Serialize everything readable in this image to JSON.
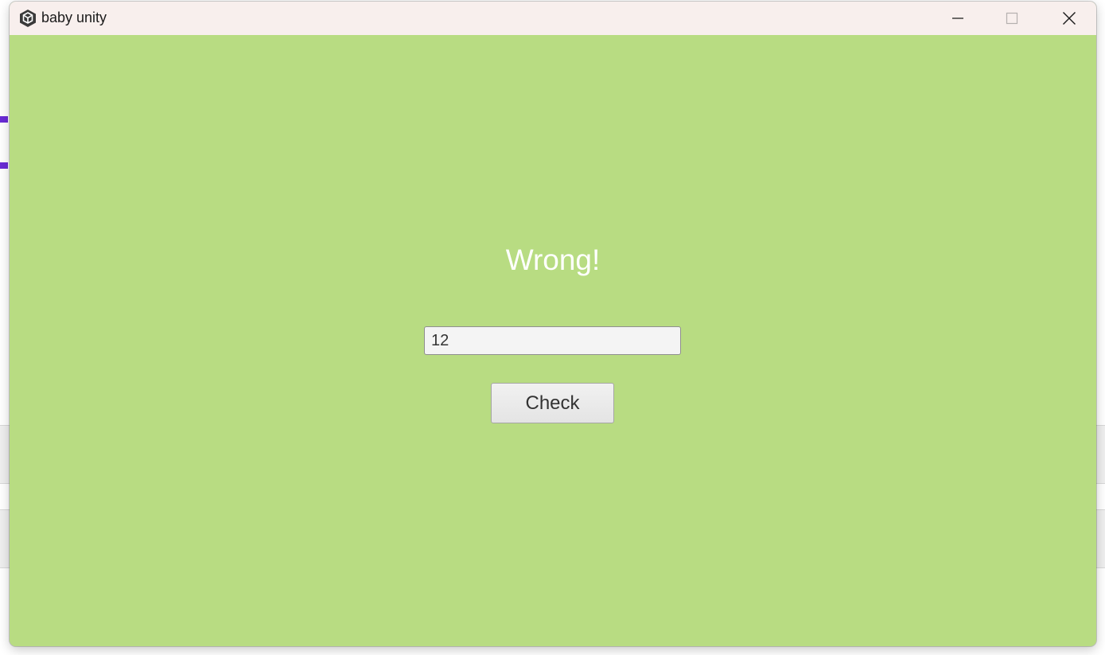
{
  "window": {
    "title": "baby unity",
    "app_icon": "unity-logo-icon",
    "controls": {
      "minimize": "minimize-icon",
      "maximize": "maximize-icon",
      "close": "close-icon"
    }
  },
  "game": {
    "message": "Wrong!",
    "answer_value": "12",
    "check_label": "Check",
    "background_color": "#b8dc82",
    "message_color": "#ffffff"
  }
}
